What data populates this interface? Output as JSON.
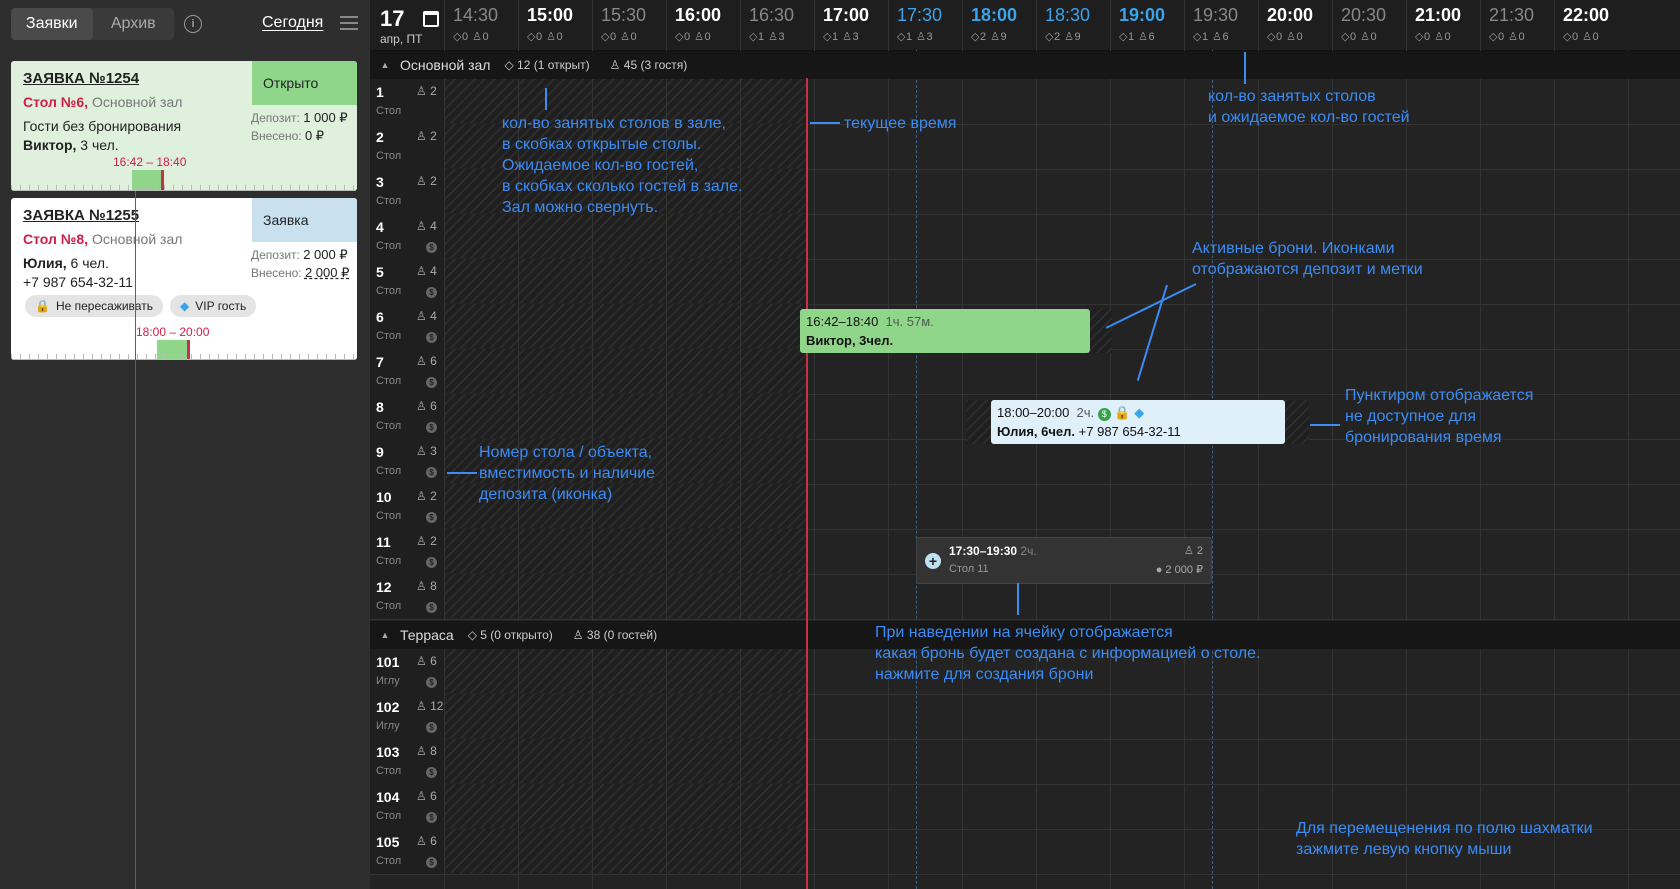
{
  "sidebar": {
    "tabs": [
      "Заявки",
      "Архив"
    ],
    "info_label": "i",
    "today_label": "Сегодня",
    "cards": [
      {
        "title": "ЗАЯВКА №1254",
        "table": "Стол №6,",
        "hall": " Основной зал",
        "status": "Открыто",
        "line3": "Гости без бронирования",
        "guest_name": "Виктор,",
        "guest_rest": " 3 чел.",
        "deposit_label": "Депозит:",
        "deposit_value": "1 000 ₽",
        "paid_label": "Внесено:",
        "paid_value": "0 ₽",
        "time_from": "16:42",
        "time_to": "18:40"
      },
      {
        "title": "ЗАЯВКА №1255",
        "table": "Стол №8,",
        "hall": " Основной зал",
        "status": "Заявка",
        "guest_name": "Юлия,",
        "guest_rest": " 6 чел.",
        "phone": "+7 987 654-32-11",
        "deposit_label": "Депозит:",
        "deposit_value": "2 000 ₽",
        "paid_label": "Внесено:",
        "paid_value": "2 000 ₽",
        "badges": [
          "Не пересаживать",
          "VIP гость"
        ],
        "time_from": "18:00",
        "time_to": "20:00"
      }
    ]
  },
  "header": {
    "day": "17",
    "sub": "апр, ПТ",
    "slots": [
      {
        "t": "14:30",
        "c": "◇0 ♙0"
      },
      {
        "t": "15:00",
        "c": "◇0 ♙0"
      },
      {
        "t": "15:30",
        "c": "◇0 ♙0"
      },
      {
        "t": "16:00",
        "c": "◇0 ♙0"
      },
      {
        "t": "16:30",
        "c": "◇1 ♙3"
      },
      {
        "t": "17:00",
        "c": "◇1 ♙3"
      },
      {
        "t": "17:30",
        "c": "◇1 ♙3"
      },
      {
        "t": "18:00",
        "c": "◇2 ♙9"
      },
      {
        "t": "18:30",
        "c": "◇2 ♙9"
      },
      {
        "t": "19:00",
        "c": "◇1 ♙6"
      },
      {
        "t": "19:30",
        "c": "◇1 ♙6"
      },
      {
        "t": "20:00",
        "c": "◇0 ♙0"
      },
      {
        "t": "20:30",
        "c": "◇0 ♙0"
      },
      {
        "t": "21:00",
        "c": "◇0 ♙0"
      },
      {
        "t": "21:30",
        "c": "◇0 ♙0"
      },
      {
        "t": "22:00",
        "c": "◇0 ♙0"
      }
    ]
  },
  "halls": [
    {
      "name": "Основной зал",
      "tables_stat": "12 (1 открыт)",
      "guests_stat": "45 (3 гостя)"
    },
    {
      "name": "Терраса",
      "tables_stat": "5 (0 открыто)",
      "guests_stat": "38 (0 гостей)"
    }
  ],
  "rows_main": [
    {
      "n": "1",
      "k": "Стол",
      "cap": "2"
    },
    {
      "n": "2",
      "k": "Стол",
      "cap": "2"
    },
    {
      "n": "3",
      "k": "Стол",
      "cap": "2"
    },
    {
      "n": "4",
      "k": "Стол",
      "cap": "4"
    },
    {
      "n": "5",
      "k": "Стол",
      "cap": "4"
    },
    {
      "n": "6",
      "k": "Стол",
      "cap": "4"
    },
    {
      "n": "7",
      "k": "Стол",
      "cap": "6"
    },
    {
      "n": "8",
      "k": "Стол",
      "cap": "6"
    },
    {
      "n": "9",
      "k": "Стол",
      "cap": "3"
    },
    {
      "n": "10",
      "k": "Стол",
      "cap": "2"
    },
    {
      "n": "11",
      "k": "Стол",
      "cap": "2"
    },
    {
      "n": "12",
      "k": "Стол",
      "cap": "8"
    }
  ],
  "rows_terrace": [
    {
      "n": "101",
      "k": "Иглу",
      "cap": "6"
    },
    {
      "n": "102",
      "k": "Иглу",
      "cap": "12"
    },
    {
      "n": "103",
      "k": "Стол",
      "cap": "8"
    },
    {
      "n": "104",
      "k": "Стол",
      "cap": "6"
    },
    {
      "n": "105",
      "k": "Стол",
      "cap": "6"
    }
  ],
  "reservations": [
    {
      "time": "16:42–18:40",
      "dur": "1ч. 57м.",
      "who": "Виктор, 3чел.",
      "phone": ""
    },
    {
      "time": "18:00–20:00",
      "dur": "2ч.",
      "who": "Юлия, 6чел.",
      "phone": "+7 987 654-32-11"
    }
  ],
  "hover": {
    "time": "17:30–19:30",
    "dur": "2ч.",
    "table": "Стол 11",
    "guests": "2",
    "deposit": "2 000 ₽"
  },
  "notes": {
    "n1": "кол-во занятых столов в зале,\nв скобках открытые столы.\nОжидаемое кол-во гостей,\nв скобках сколько гостей в зале.\nЗал можно свернуть.",
    "n2": "текущее время",
    "n3": "кол-во занятых столов\nи ожидаемое кол-во гостей",
    "n4": "Активные брони. Иконками\nотображаются депозит и метки",
    "n5": "Пунктиром отображается\nне доступное для\nбронирования время",
    "n6": "Номер стола / объекта,\nвместимость и наличие\nдепозита (иконка)",
    "n7": "При наведении на ячейку отображается\nкакая бронь будет создана с информацией о столе.\nнажмите для создания брони",
    "n8": "Для перемещенения по полю шахматки\nзажмите левую кнопку мыши"
  },
  "colors": {
    "accent": "#3b8cf5",
    "now_line": "#c8304a",
    "open": "#8fd68a",
    "request": "#c9e1ee",
    "table_red": "#d11d48"
  }
}
